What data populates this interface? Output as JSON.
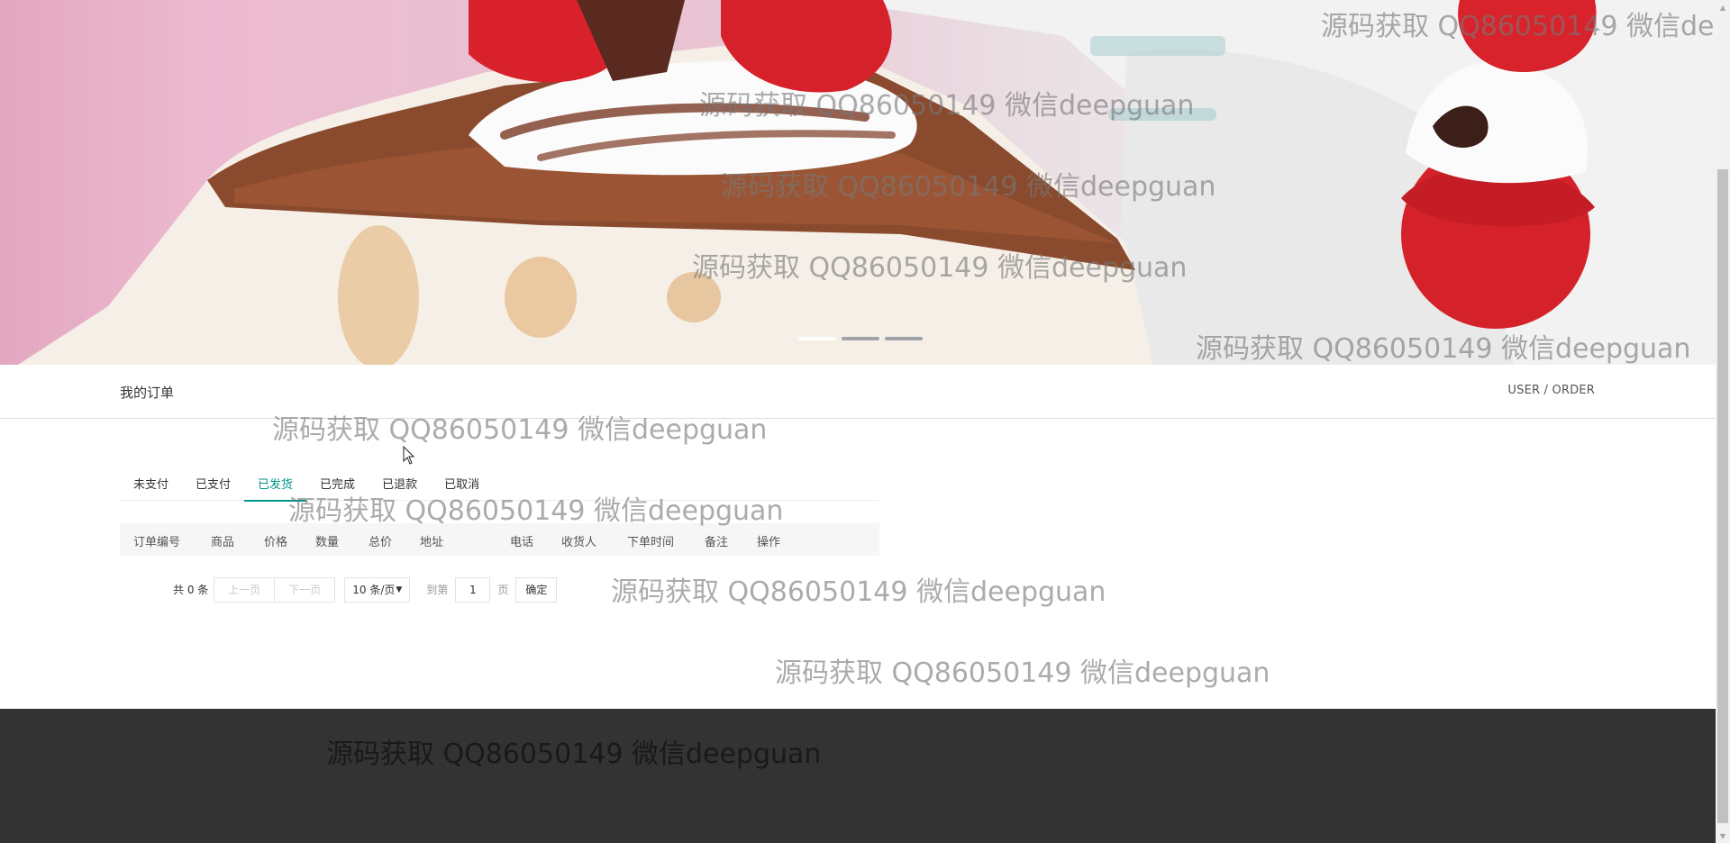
{
  "banner": {
    "slides": [
      {
        "active": true
      },
      {
        "active": false
      },
      {
        "active": false
      }
    ]
  },
  "section": {
    "title": "我的订单",
    "crumb": "USER / ORDER"
  },
  "tabs": [
    {
      "label": "未支付",
      "active": false
    },
    {
      "label": "已支付",
      "active": false
    },
    {
      "label": "已发货",
      "active": true
    },
    {
      "label": "已完成",
      "active": false
    },
    {
      "label": "已退款",
      "active": false
    },
    {
      "label": "已取消",
      "active": false
    }
  ],
  "table": {
    "columns": [
      "订单编号",
      "商品",
      "价格",
      "数量",
      "总价",
      "地址",
      "电话",
      "收货人",
      "下单时间",
      "备注",
      "操作"
    ],
    "rows": []
  },
  "pager": {
    "count_text": "共 0 条",
    "prev": "上一页",
    "next": "下一页",
    "page_size": "10 条/页",
    "skip_label": "到第",
    "page_value": "1",
    "page_unit": "页",
    "confirm": "确定"
  },
  "watermark": {
    "text": "源码获取 QQ86050149 微信deepguan",
    "text_cut": "源码获取 QQ86050149 微信deep"
  },
  "colors": {
    "accent": "#009688",
    "footer": "#333333"
  }
}
